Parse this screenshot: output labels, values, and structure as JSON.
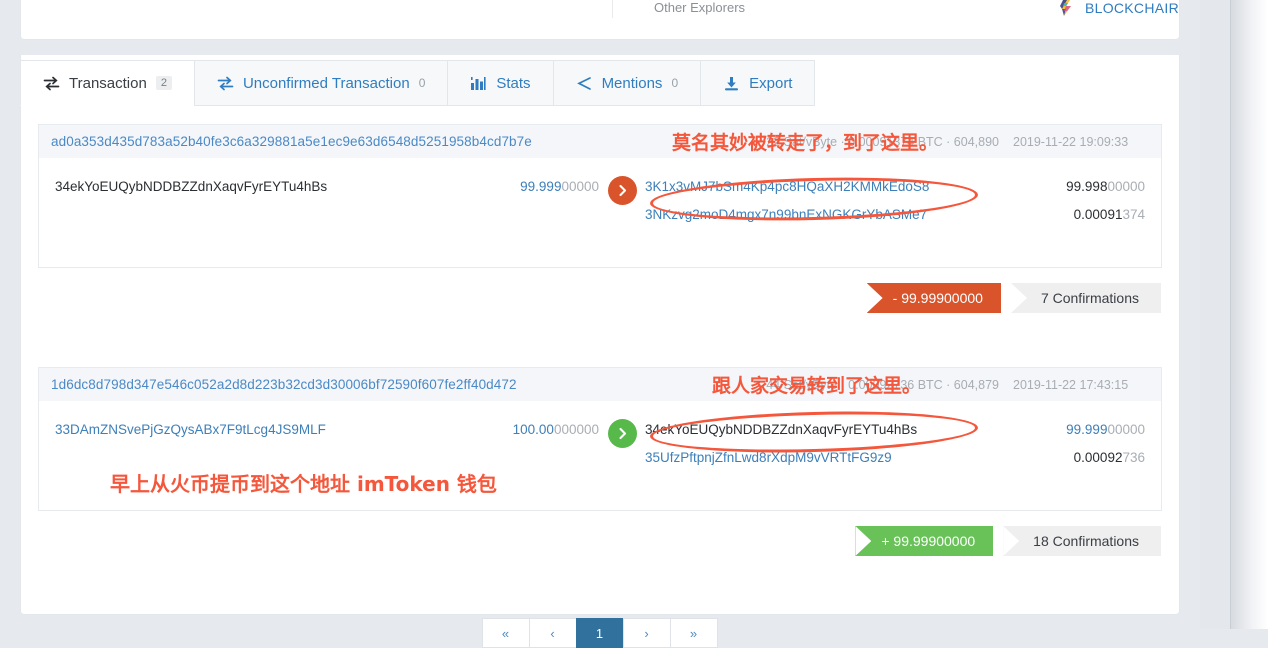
{
  "top": {
    "other_explorers_label": "Other Explorers",
    "blockchair_label": "BLOCKCHAIR",
    "blockchair_icon": "blockchair-logo-icon"
  },
  "tabs": [
    {
      "id": "transaction",
      "label": "Transaction",
      "count": "2",
      "icon": "transfer-arrows-icon",
      "active": true
    },
    {
      "id": "unconfirmed-transaction",
      "label": "Unconfirmed Transaction",
      "count": "0",
      "icon": "transfer-arrows-icon",
      "active": false
    },
    {
      "id": "stats",
      "label": "Stats",
      "count": "",
      "icon": "bar-chart-icon",
      "active": false
    },
    {
      "id": "mentions",
      "label": "Mentions",
      "count": "0",
      "icon": "share-nodes-icon",
      "active": false
    },
    {
      "id": "export",
      "label": "Export",
      "count": "",
      "icon": "download-icon",
      "active": false
    }
  ],
  "transactions": [
    {
      "hash": "ad0a353d435d783a52b40fe3c6a329881a5e1ec9e63d6548d5251958b4cd7b7e",
      "meta": "22 Sat/vByte · 0.00091374 BTC · 604,890",
      "date": "2019-11-22 19:09:33",
      "inputs": [
        {
          "address": "34ekYoEUQybNDDBZZdnXaqvFyrEYTu4hBs",
          "address_style": "black",
          "amount_lead": "99.999",
          "amount_tail": "00000",
          "amount_style": "blue"
        }
      ],
      "outputs": [
        {
          "address": "3K1x3vMJ7bSm4Kp4pc8HQaXH2KMMkEdoS8",
          "address_style": "link",
          "amount_lead": "99.998",
          "amount_tail": "00000",
          "amount_style": "dark",
          "highlighted": true
        },
        {
          "address": "3NKzvg2moD4mgx7n99bnExNGKGrYbASMe7",
          "address_style": "link",
          "amount_lead": "0.00091",
          "amount_tail": "374",
          "amount_style": "dark",
          "highlighted": false
        }
      ],
      "direction_icon": "chevron-right-circle-icon",
      "direction_color": "#d9542b",
      "value_badge": "- 99.99900000",
      "value_badge_type": "negative",
      "confirmations_badge": "7 Confirmations"
    },
    {
      "hash": "1d6dc8d798d347e546c052a2d8d223b32cd3d30006bf72590f607fe2ff40d472",
      "meta": "44 Sat/vByte · 0.00092736 BTC · 604,879",
      "date": "2019-11-22 17:43:15",
      "inputs": [
        {
          "address": "33DAmZNSvePjGzQysABx7F9tLcg4JS9MLF",
          "address_style": "link",
          "amount_lead": "100.00",
          "amount_tail": "000000",
          "amount_style": "blue"
        }
      ],
      "outputs": [
        {
          "address": "34ekYoEUQybNDDBZZdnXaqvFyrEYTu4hBs",
          "address_style": "black",
          "amount_lead": "99.999",
          "amount_tail": "00000",
          "amount_style": "blue",
          "highlighted": true
        },
        {
          "address": "35UfzPftpnjZfnLwd8rXdpM9vVRTtFG9z9",
          "address_style": "link",
          "amount_lead": "0.00092",
          "amount_tail": "736",
          "amount_style": "dark",
          "highlighted": false
        }
      ],
      "direction_icon": "chevron-right-circle-icon",
      "direction_color": "#56b949",
      "value_badge": "+ 99.99900000",
      "value_badge_type": "positive",
      "confirmations_badge": "18 Confirmations"
    }
  ],
  "annotations": [
    {
      "id": "anno-tx1-header",
      "text": "莫名其妙被转走了，到了这里。",
      "color": "#f4573b"
    },
    {
      "id": "anno-tx2-header",
      "text": "跟人家交易转到了这里。",
      "color": "#f4573b"
    },
    {
      "id": "anno-tx2-input",
      "text": "早上从火币提币到这个地址 imToken 钱包",
      "color": "#f4573b"
    }
  ],
  "pagination": [
    {
      "label": "«",
      "current": false
    },
    {
      "label": "‹",
      "current": false
    },
    {
      "label": "1",
      "current": true
    },
    {
      "label": "›",
      "current": false
    },
    {
      "label": "»",
      "current": false
    }
  ]
}
